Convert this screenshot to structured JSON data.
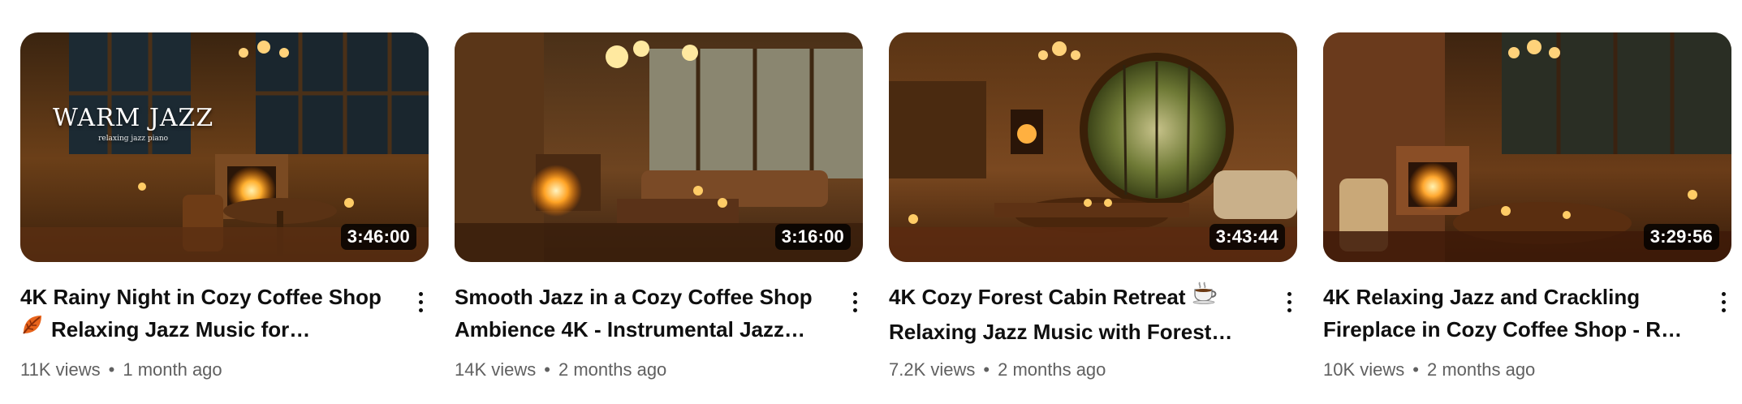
{
  "videos": [
    {
      "title_line1": "4K Rainy Night in Cozy Coffee Shop",
      "title_line2": "Relaxing Jazz Music for…",
      "emoji": "leaf-emoji-icon",
      "duration": "3:46:00",
      "views": "11K views",
      "age": "1 month ago",
      "thumb_text": "WARM JAZZ",
      "thumb_subtext": "relaxing jazz piano"
    },
    {
      "title_line1": "Smooth Jazz in a Cozy Coffee Shop",
      "title_line2": "Ambience 4K - Instrumental Jazz…",
      "duration": "3:16:00",
      "views": "14K views",
      "age": "2 months ago"
    },
    {
      "title_line1": "4K Cozy Forest Cabin Retreat",
      "title_line2": "Relaxing Jazz Music with Forest…",
      "emoji": "coffee-emoji-icon",
      "duration": "3:43:44",
      "views": "7.2K views",
      "age": "2 months ago"
    },
    {
      "title_line1": "4K Relaxing Jazz and Crackling",
      "title_line2": "Fireplace in Cozy Coffee Shop - Ra…",
      "duration": "3:29:56",
      "views": "10K views",
      "age": "2 months ago"
    }
  ],
  "separator": "•",
  "colors": {
    "title": "#0f0f0f",
    "meta": "#606060",
    "duration_bg": "#000000cc",
    "duration_text": "#ffffff"
  }
}
